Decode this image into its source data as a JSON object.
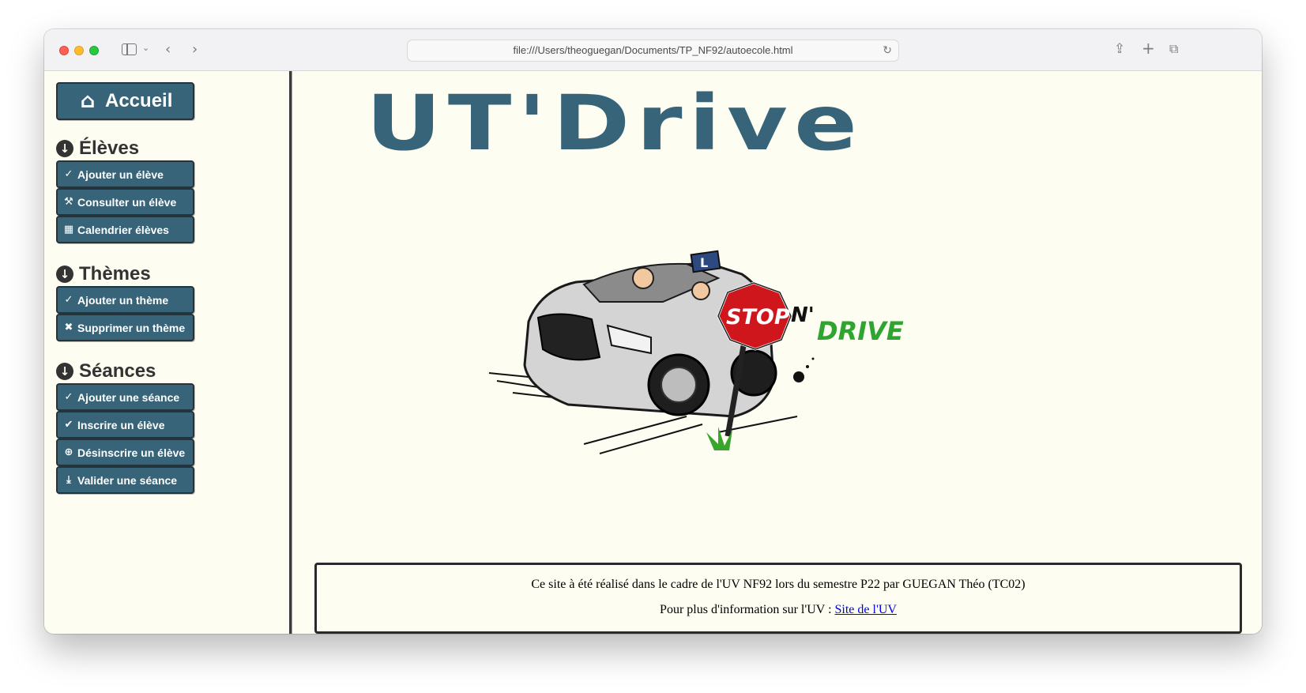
{
  "browser": {
    "url": "file:///Users/theoguegan/Documents/TP_NF92/autoecole.html"
  },
  "sidebar": {
    "home_label": "Accueil",
    "sections": [
      {
        "title": "Élèves",
        "buttons": [
          {
            "icon": "check-icon",
            "label": "Ajouter un élève"
          },
          {
            "icon": "wrench-icon",
            "label": "Consulter un élève"
          },
          {
            "icon": "calendar-icon",
            "label": "Calendrier élèves"
          }
        ]
      },
      {
        "title": "Thèmes",
        "buttons": [
          {
            "icon": "check-icon",
            "label": "Ajouter un thème"
          },
          {
            "icon": "close-icon",
            "label": "Supprimer un thème"
          }
        ]
      },
      {
        "title": "Séances",
        "buttons": [
          {
            "icon": "check-icon",
            "label": "Ajouter une séance"
          },
          {
            "icon": "check-circle-icon",
            "label": "Inscrire un élève"
          },
          {
            "icon": "plus-circle-icon",
            "label": "Désinscrire un élève"
          },
          {
            "icon": "download-icon",
            "label": "Valider une séance"
          }
        ]
      }
    ]
  },
  "main": {
    "logo_text": "UT'Drive",
    "art_stop_text": "STOP",
    "art_n_text": "N'",
    "art_drive_text": "DRIVE",
    "art_plate_text": "L"
  },
  "footer": {
    "line1": "Ce site à été réalisé dans le cadre de l'UV NF92 lors du semestre P22 par GUEGAN Théo (TC02)",
    "line2_prefix": "Pour plus d'information sur l'UV : ",
    "link_text": "Site de l'UV"
  },
  "colors": {
    "button_bg": "#376479",
    "logo": "#376479",
    "page_bg": "#fdfdf1"
  }
}
